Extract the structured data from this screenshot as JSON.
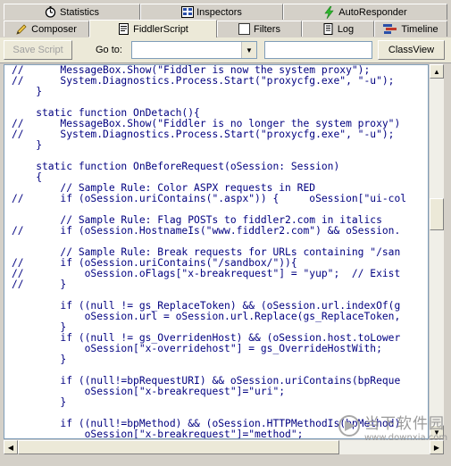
{
  "tabs_top": [
    {
      "label": "Statistics",
      "icon": "stopwatch-icon"
    },
    {
      "label": "Inspectors",
      "icon": "inspectors-icon"
    },
    {
      "label": "AutoResponder",
      "icon": "lightning-icon"
    }
  ],
  "tabs_bottom": [
    {
      "label": "Composer",
      "icon": "pencil-icon"
    },
    {
      "label": "FiddlerScript",
      "icon": "script-icon",
      "active": true
    },
    {
      "label": "Filters",
      "icon": "checkbox-icon"
    },
    {
      "label": "Log",
      "icon": "log-icon"
    },
    {
      "label": "Timeline",
      "icon": "timeline-icon"
    }
  ],
  "toolbar": {
    "save_label": "Save Script",
    "goto_label": "Go to:",
    "goto_value": "",
    "search_value": "",
    "classview_label": "ClassView"
  },
  "code_lines": [
    "//      MessageBox.Show(\"Fiddler is now the system proxy\");",
    "//      System.Diagnostics.Process.Start(\"proxycfg.exe\", \"-u\");",
    "    }",
    "",
    "    static function OnDetach(){",
    "//      MessageBox.Show(\"Fiddler is no longer the system proxy\")",
    "//      System.Diagnostics.Process.Start(\"proxycfg.exe\", \"-u\");",
    "    }",
    "",
    "    static function OnBeforeRequest(oSession: Session)",
    "    {",
    "        // Sample Rule: Color ASPX requests in RED",
    "//      if (oSession.uriContains(\".aspx\")) {     oSession[\"ui-col",
    "",
    "        // Sample Rule: Flag POSTs to fiddler2.com in italics",
    "//      if (oSession.HostnameIs(\"www.fiddler2.com\") && oSession.",
    "",
    "        // Sample Rule: Break requests for URLs containing \"/san",
    "//      if (oSession.uriContains(\"/sandbox/\")){",
    "//          oSession.oFlags[\"x-breakrequest\"] = \"yup\";  // Exist",
    "//      }",
    "",
    "        if ((null != gs_ReplaceToken) && (oSession.url.indexOf(g",
    "            oSession.url = oSession.url.Replace(gs_ReplaceToken,",
    "        }",
    "        if ((null != gs_OverridenHost) && (oSession.host.toLower",
    "            oSession[\"x-overridehost\"] = gs_OverrideHostWith;",
    "        }",
    "",
    "        if ((null!=bpRequestURI) && oSession.uriContains(bpReque",
    "            oSession[\"x-breakrequest\"]=\"uri\";",
    "        }",
    "",
    "        if ((null!=bpMethod) && (oSession.HTTPMethodIs(bpMethod)",
    "            oSession[\"x-breakrequest\"]=\"method\";",
    "        }"
  ],
  "watermark": {
    "cn": "当下软件园",
    "url": "www.downxia.com"
  }
}
